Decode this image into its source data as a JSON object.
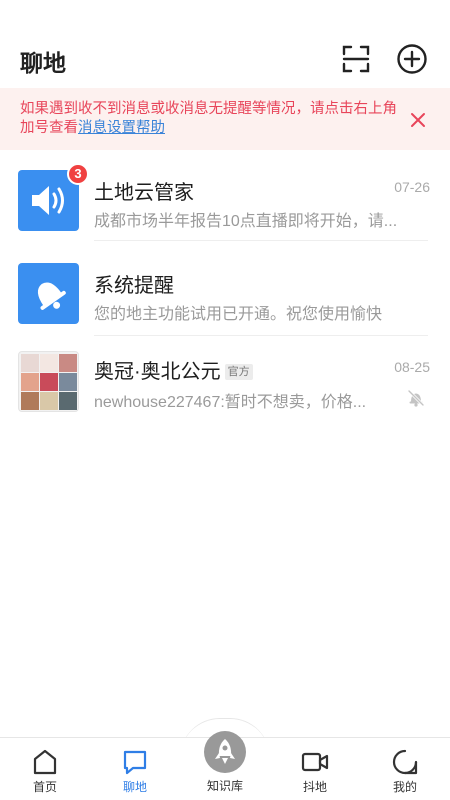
{
  "header": {
    "title": "聊地"
  },
  "notice": {
    "text": "如果遇到收不到消息或收消息无提醒等情况，请点击右上角加号查看",
    "link": "消息设置帮助"
  },
  "chats": [
    {
      "name": "土地云管家",
      "time": "07-26",
      "preview": "成都市场半年报告10点直播即将开始，请...",
      "badge": "3"
    },
    {
      "name": "系统提醒",
      "time": "",
      "preview": "您的地主功能试用已开通。祝您使用愉快"
    },
    {
      "name": "奥冠·奥北公元",
      "tag": "官方",
      "time": "08-25",
      "preview": "newhouse227467:暂时不想卖，价格..."
    }
  ],
  "tabs": [
    {
      "label": "首页"
    },
    {
      "label": "聊地"
    },
    {
      "label": "知识库"
    },
    {
      "label": "抖地"
    },
    {
      "label": "我的"
    }
  ],
  "colors": {
    "accent": "#2f7ee6",
    "badge": "#f04141",
    "notice_text": "#e8455a",
    "notice_bg": "#fdf1ef"
  }
}
